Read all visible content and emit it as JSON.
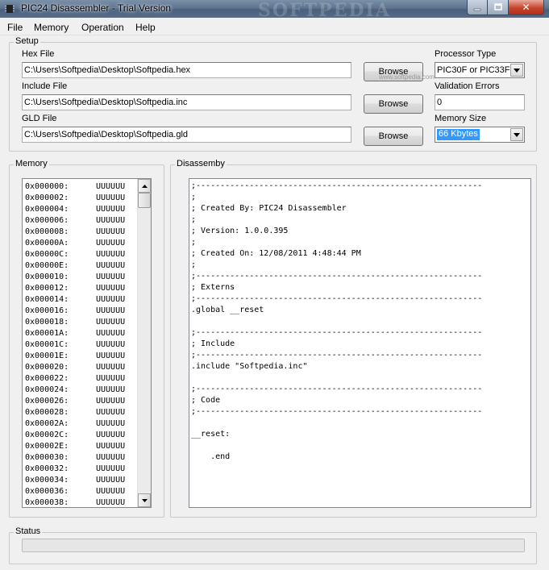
{
  "window": {
    "title": "PIC24 Disassembler - Trial Version",
    "watermark": "SOFTPEDIA",
    "close_glyph": "✕"
  },
  "menu": [
    "File",
    "Memory",
    "Operation",
    "Help"
  ],
  "setup": {
    "group_label": "Setup",
    "hex_label": "Hex File",
    "hex_value": "C:\\Users\\Softpedia\\Desktop\\Softpedia.hex",
    "include_label": "Include File",
    "include_value": "C:\\Users\\Softpedia\\Desktop\\Softpedia.inc",
    "gld_label": "GLD File",
    "gld_value": "C:\\Users\\Softpedia\\Desktop\\Softpedia.gld",
    "browse_label": "Browse",
    "processor_label": "Processor Type",
    "processor_value": "PIC30F or PIC33F",
    "validation_label": "Validation Errors",
    "validation_value": "0",
    "memsize_label": "Memory Size",
    "memsize_value": "66 Kbytes",
    "watermark_url": "www.softpedia.com"
  },
  "memory": {
    "group_label": "Memory",
    "rows": [
      {
        "addr": "0x000000:",
        "val": "UUUUUU"
      },
      {
        "addr": "0x000002:",
        "val": "UUUUUU"
      },
      {
        "addr": "0x000004:",
        "val": "UUUUUU"
      },
      {
        "addr": "0x000006:",
        "val": "UUUUUU"
      },
      {
        "addr": "0x000008:",
        "val": "UUUUUU"
      },
      {
        "addr": "0x00000A:",
        "val": "UUUUUU"
      },
      {
        "addr": "0x00000C:",
        "val": "UUUUUU"
      },
      {
        "addr": "0x00000E:",
        "val": "UUUUUU"
      },
      {
        "addr": "0x000010:",
        "val": "UUUUUU"
      },
      {
        "addr": "0x000012:",
        "val": "UUUUUU"
      },
      {
        "addr": "0x000014:",
        "val": "UUUUUU"
      },
      {
        "addr": "0x000016:",
        "val": "UUUUUU"
      },
      {
        "addr": "0x000018:",
        "val": "UUUUUU"
      },
      {
        "addr": "0x00001A:",
        "val": "UUUUUU"
      },
      {
        "addr": "0x00001C:",
        "val": "UUUUUU"
      },
      {
        "addr": "0x00001E:",
        "val": "UUUUUU"
      },
      {
        "addr": "0x000020:",
        "val": "UUUUUU"
      },
      {
        "addr": "0x000022:",
        "val": "UUUUUU"
      },
      {
        "addr": "0x000024:",
        "val": "UUUUUU"
      },
      {
        "addr": "0x000026:",
        "val": "UUUUUU"
      },
      {
        "addr": "0x000028:",
        "val": "UUUUUU"
      },
      {
        "addr": "0x00002A:",
        "val": "UUUUUU"
      },
      {
        "addr": "0x00002C:",
        "val": "UUUUUU"
      },
      {
        "addr": "0x00002E:",
        "val": "UUUUUU"
      },
      {
        "addr": "0x000030:",
        "val": "UUUUUU"
      },
      {
        "addr": "0x000032:",
        "val": "UUUUUU"
      },
      {
        "addr": "0x000034:",
        "val": "UUUUUU"
      },
      {
        "addr": "0x000036:",
        "val": "UUUUUU"
      },
      {
        "addr": "0x000038:",
        "val": "UUUUUU"
      }
    ]
  },
  "disassembly": {
    "group_label": "Disassemby",
    "lines": [
      ";-----------------------------------------------------------",
      ";",
      "; Created By: PIC24 Disassembler",
      ";",
      "; Version: 1.0.0.395",
      ";",
      "; Created On: 12/08/2011 4:48:44 PM",
      ";",
      ";-----------------------------------------------------------",
      "; Externs",
      ";-----------------------------------------------------------",
      ".global __reset",
      "",
      ";-----------------------------------------------------------",
      "; Include",
      ";-----------------------------------------------------------",
      ".include \"Softpedia.inc\"",
      "",
      ";-----------------------------------------------------------",
      "; Code",
      ";-----------------------------------------------------------",
      "",
      "__reset:",
      "",
      "    .end"
    ]
  },
  "status": {
    "group_label": "Status"
  }
}
